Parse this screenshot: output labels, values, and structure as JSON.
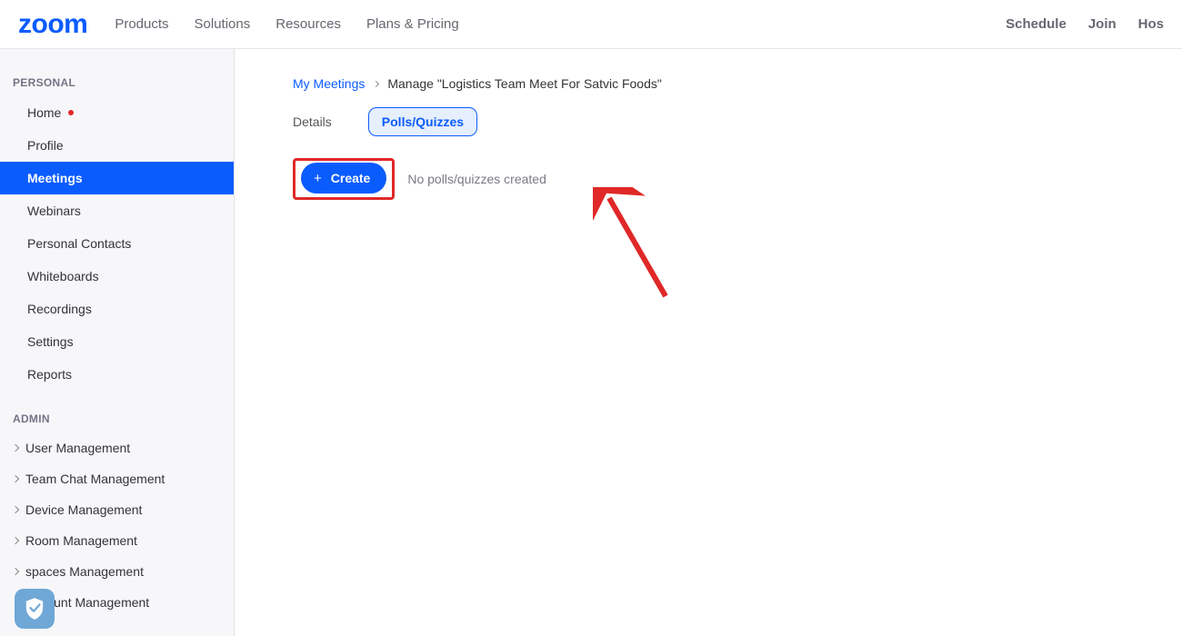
{
  "brand": "zoom",
  "topnav": {
    "left": [
      "Products",
      "Solutions",
      "Resources",
      "Plans & Pricing"
    ],
    "right": [
      "Schedule",
      "Join",
      "Hos"
    ]
  },
  "sidebar": {
    "personal_title": "PERSONAL",
    "personal": [
      {
        "label": "Home",
        "active": false,
        "dot": true
      },
      {
        "label": "Profile",
        "active": false,
        "dot": false
      },
      {
        "label": "Meetings",
        "active": true,
        "dot": false
      },
      {
        "label": "Webinars",
        "active": false,
        "dot": false
      },
      {
        "label": "Personal Contacts",
        "active": false,
        "dot": false
      },
      {
        "label": "Whiteboards",
        "active": false,
        "dot": false
      },
      {
        "label": "Recordings",
        "active": false,
        "dot": false
      },
      {
        "label": "Settings",
        "active": false,
        "dot": false
      },
      {
        "label": "Reports",
        "active": false,
        "dot": false
      }
    ],
    "admin_title": "ADMIN",
    "admin": [
      {
        "label": "User Management"
      },
      {
        "label": "Team Chat Management"
      },
      {
        "label": "Device Management"
      },
      {
        "label": "Room Management"
      },
      {
        "label": "spaces Management"
      },
      {
        "label": "Account Management"
      }
    ]
  },
  "breadcrumb": {
    "link": "My Meetings",
    "current": "Manage \"Logistics Team Meet For Satvic Foods\""
  },
  "tabs": {
    "details": "Details",
    "polls": "Polls/Quizzes"
  },
  "action": {
    "create": "Create",
    "empty": "No polls/quizzes created"
  },
  "colors": {
    "accent": "#0b5cff",
    "highlight": "#e02828"
  }
}
